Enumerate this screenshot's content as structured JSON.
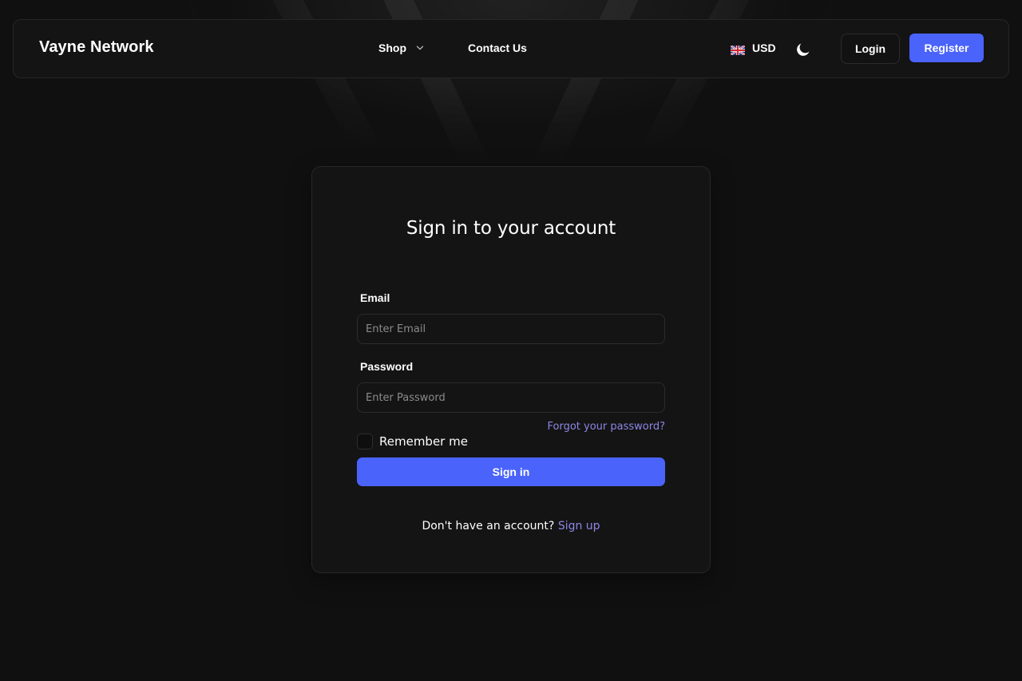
{
  "header": {
    "brand": "Vayne Network",
    "nav": {
      "shop_label": "Shop",
      "contact_label": "Contact Us"
    },
    "currency": {
      "flag_icon": "uk-flag-icon",
      "label": "USD"
    },
    "theme_icon": "moon-icon",
    "login_label": "Login",
    "register_label": "Register"
  },
  "signin": {
    "title": "Sign in to your account",
    "email_label": "Email",
    "email_value": "",
    "email_placeholder": "Enter Email",
    "password_label": "Password",
    "password_value": "",
    "password_placeholder": "Enter Password",
    "forgot_label": "Forgot your password?",
    "remember_label": "Remember me",
    "remember_checked": false,
    "submit_label": "Sign in",
    "no_account_text": "Don't have an account?",
    "signup_label": "Sign up"
  },
  "colors": {
    "background": "#101010",
    "surface": "#141414",
    "accent": "#4a63fb",
    "link": "#8d86e6",
    "text": "#ffffff",
    "placeholder": "#8a8a8a"
  }
}
